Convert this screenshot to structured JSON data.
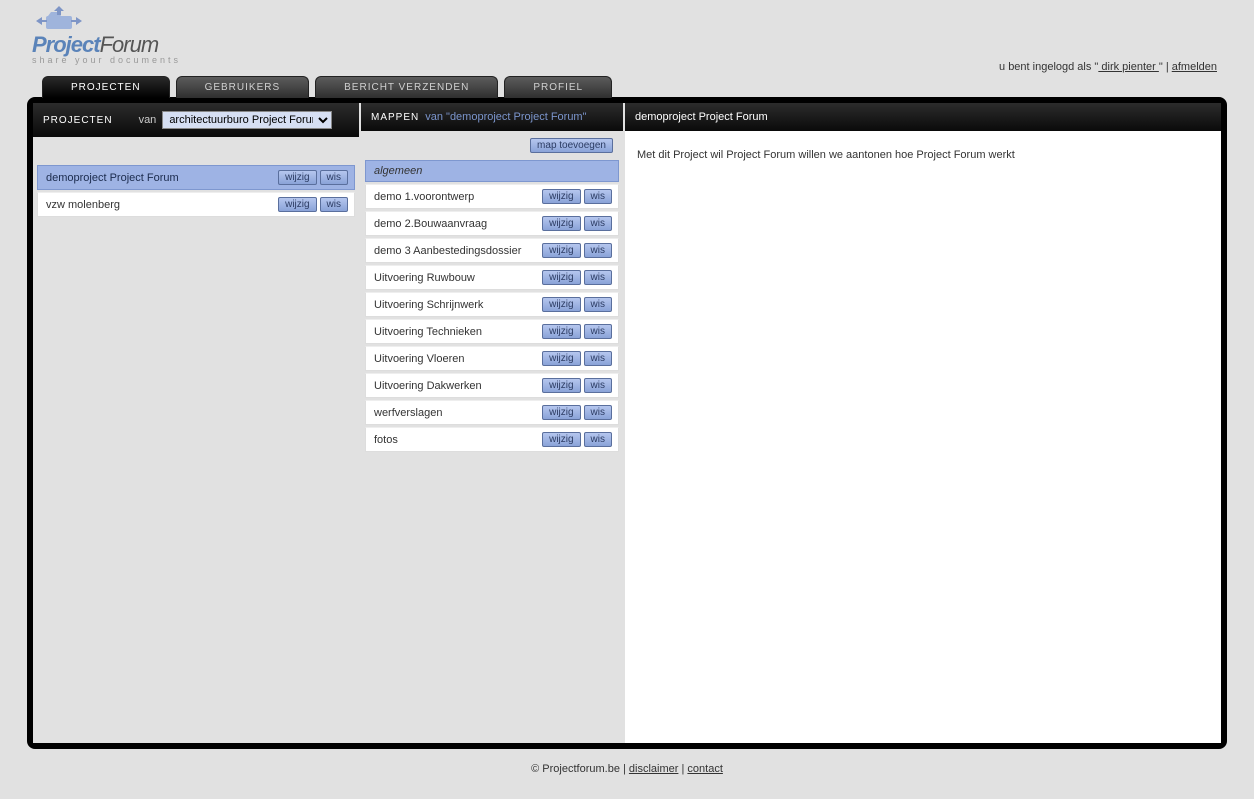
{
  "brand": {
    "part1": "Project",
    "part2": "Forum",
    "tagline": "share your documents"
  },
  "login": {
    "prefix": "u bent ingelogd als \"",
    "user": " dirk pienter ",
    "suffix": "\" | ",
    "logout": "afmelden"
  },
  "tabs": [
    {
      "label": "PROJECTEN",
      "active": true
    },
    {
      "label": "GEBRUIKERS",
      "active": false
    },
    {
      "label": "BERICHT VERZENDEN",
      "active": false
    },
    {
      "label": "PROFIEL",
      "active": false
    }
  ],
  "col1": {
    "title": "PROJECTEN",
    "van": "van",
    "select_value": "architectuurburo Project Forum",
    "items": [
      {
        "name": "demoproject Project Forum",
        "selected": true
      },
      {
        "name": "vzw molenberg",
        "selected": false
      }
    ]
  },
  "col2": {
    "title": "MAPPEN",
    "sub_prefix": "van \"",
    "sub_value": "demoproject Project Forum",
    "sub_suffix": "\"",
    "add_label": "map toevoegen",
    "header": "algemeen",
    "items": [
      {
        "name": "demo 1.voorontwerp"
      },
      {
        "name": "demo 2.Bouwaanvraag"
      },
      {
        "name": "demo 3 Aanbestedingsdossier"
      },
      {
        "name": "Uitvoering Ruwbouw"
      },
      {
        "name": "Uitvoering Schrijnwerk"
      },
      {
        "name": "Uitvoering Technieken"
      },
      {
        "name": "Uitvoering Vloeren"
      },
      {
        "name": "Uitvoering Dakwerken"
      },
      {
        "name": "werfverslagen"
      },
      {
        "name": "fotos"
      }
    ]
  },
  "col3": {
    "title": "demoproject Project Forum",
    "body": "Met dit Project wil Project Forum willen we aantonen hoe Project Forum werkt"
  },
  "buttons": {
    "edit": "wijzig",
    "delete": "wis"
  },
  "footer": {
    "copyright": "© Projectforum.be | ",
    "disclaimer": "disclaimer",
    "sep": " | ",
    "contact": "contact"
  }
}
